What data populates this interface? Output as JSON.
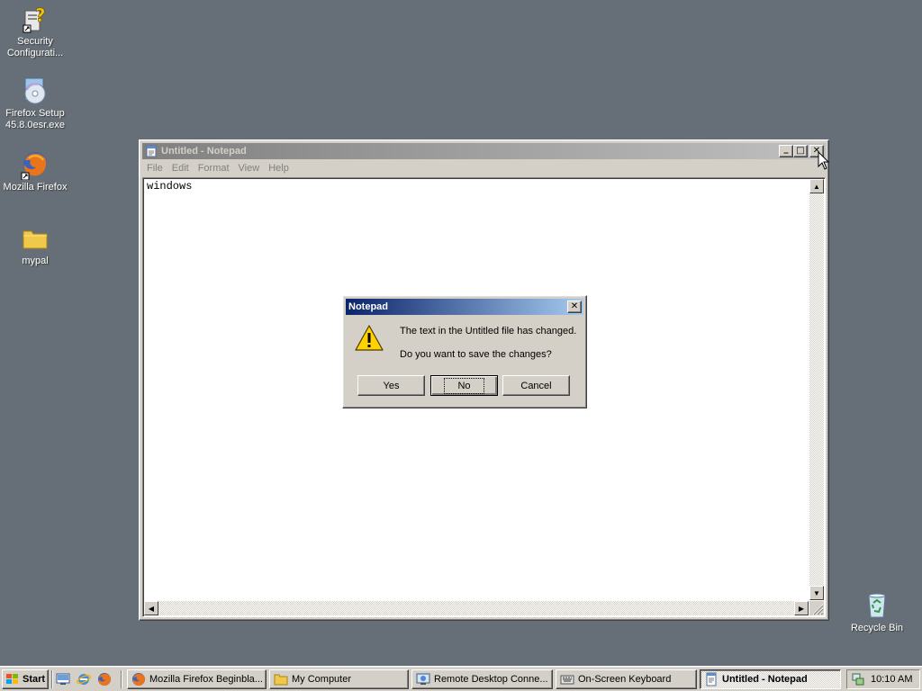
{
  "desktop": {
    "icons": [
      {
        "label": "Security Configurati...",
        "icon": "security-config-icon"
      },
      {
        "label": "Firefox Setup 45.8.0esr.exe",
        "icon": "installer-cd-icon"
      },
      {
        "label": "Mozilla Firefox",
        "icon": "firefox-icon"
      },
      {
        "label": "mypal",
        "icon": "folder-icon"
      },
      {
        "label": "Recycle Bin",
        "icon": "recycle-bin-icon"
      }
    ]
  },
  "notepad": {
    "title": "Untitled - Notepad",
    "menu": [
      "File",
      "Edit",
      "Format",
      "View",
      "Help"
    ],
    "content": "windows",
    "buttons": {
      "minimize": "_",
      "maximize": "□",
      "close": "✕"
    }
  },
  "dialog": {
    "title": "Notepad",
    "message_line1": "The text in the Untitled file has changed.",
    "message_line2": "Do you want to save the changes?",
    "yes_label": "Yes",
    "no_label": "No",
    "cancel_label": "Cancel",
    "close": "✕"
  },
  "taskbar": {
    "start_label": "Start",
    "quick_launch": [
      "show-desktop-icon",
      "ie-icon",
      "firefox-icon"
    ],
    "tasks": [
      {
        "label": "Mozilla Firefox Beginbla...",
        "icon": "firefox-icon",
        "active": false
      },
      {
        "label": "My Computer",
        "icon": "folder-icon",
        "active": false
      },
      {
        "label": "Remote Desktop Conne...",
        "icon": "remote-desktop-icon",
        "active": false
      },
      {
        "label": "On-Screen Keyboard",
        "icon": "keyboard-icon",
        "active": false
      },
      {
        "label": "Untitled - Notepad",
        "icon": "notepad-icon",
        "active": true
      }
    ],
    "clock": "10:10 AM"
  },
  "colors": {
    "desktop": "#666f77",
    "active_title_start": "#0a246a",
    "active_title_end": "#a6caf0",
    "inactive_title_start": "#808080",
    "inactive_title_end": "#c0c0c0",
    "chrome": "#d4d0c8"
  }
}
